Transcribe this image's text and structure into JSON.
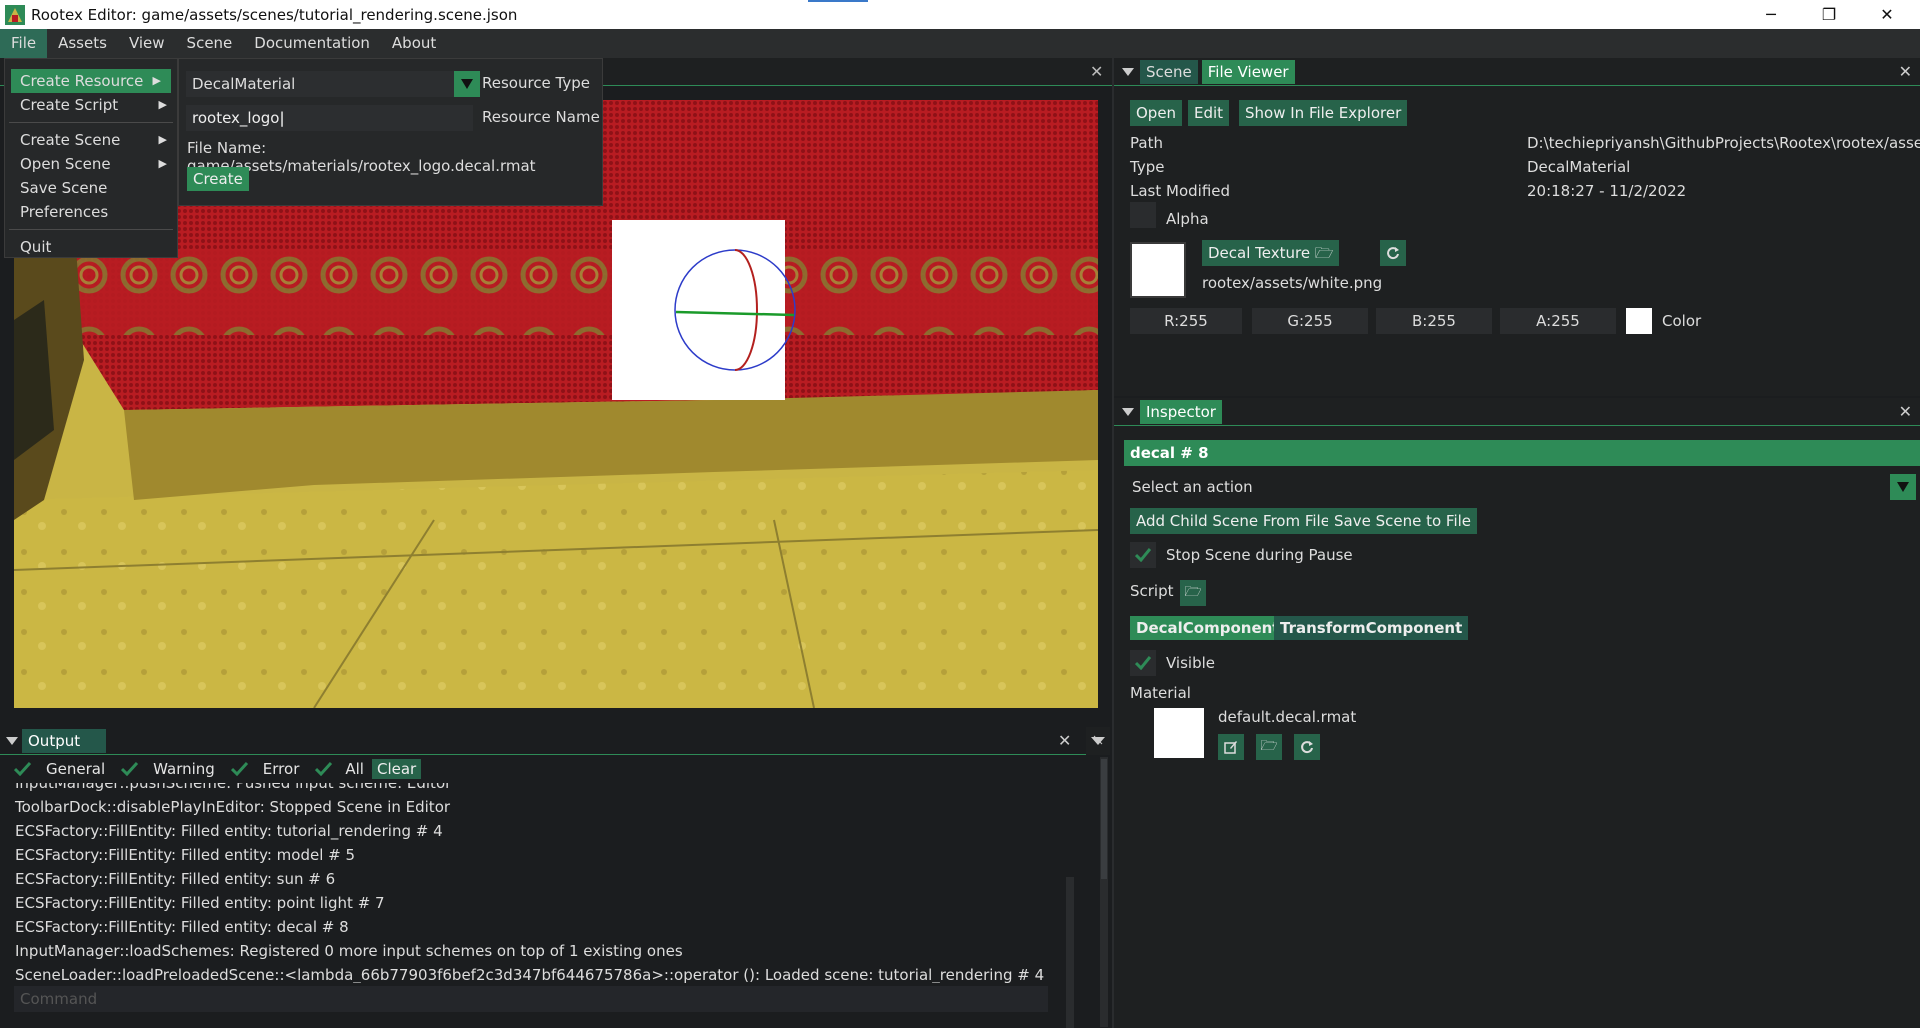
{
  "window": {
    "title": "Rootex Editor: game/assets/scenes/tutorial_rendering.scene.json",
    "minimize": "─",
    "maximize": "❐",
    "close": "✕"
  },
  "menubar": [
    "File",
    "Assets",
    "View",
    "Scene",
    "Documentation",
    "About"
  ],
  "file_menu": {
    "items": [
      {
        "label": "Create Resource",
        "submenu": true
      },
      {
        "label": "Create Script",
        "submenu": true
      },
      {
        "label": "Create Scene",
        "submenu": true
      },
      {
        "label": "Open Scene",
        "submenu": true
      },
      {
        "label": "Save Scene",
        "submenu": false
      },
      {
        "label": "Preferences",
        "submenu": false
      },
      {
        "label": "Quit",
        "submenu": false
      }
    ]
  },
  "create_resource": {
    "type_value": "DecalMaterial",
    "type_label": "Resource Type",
    "name_value": "rootex_logo",
    "name_label": "Resource Name",
    "file_name": "File Name: game/assets/materials/rootex_logo.decal.rmat",
    "create_label": "Create"
  },
  "file_viewer": {
    "tabs": [
      "Scene",
      "File Viewer"
    ],
    "buttons": [
      "Open",
      "Edit",
      "Show In File Explorer"
    ],
    "path_label": "Path",
    "path_value": "D:\\techiepriyansh\\GithubProjects\\Rootex\\rootex/assets/",
    "type_label": "Type",
    "type_value": "DecalMaterial",
    "modified_label": "Last Modified",
    "modified_value": "20:18:27 - 11/2/2022",
    "alpha_label": "Alpha",
    "decal_texture_label": "Decal Texture",
    "texture_path": "rootex/assets/white.png",
    "r": "R:255",
    "g": "G:255",
    "b": "B:255",
    "a": "A:255",
    "color_label": "Color"
  },
  "inspector": {
    "tab": "Inspector",
    "entity": "decal # 8",
    "action_placeholder": "Select an action",
    "add_child": "Add Child Scene From File",
    "save_scene": "Save Scene to File",
    "stop_scene": "Stop Scene during Pause",
    "script_label": "Script",
    "components": [
      "DecalComponent",
      "TransformComponent"
    ],
    "visible_label": "Visible",
    "material_label": "Material",
    "material_value": "default.decal.rmat"
  },
  "output": {
    "tab": "Output",
    "filters": [
      "General",
      "Warning",
      "Error",
      "All"
    ],
    "clear_label": "Clear",
    "lines": [
      "InputManager::pushScheme: Pushed input scheme: Editor",
      "ToolbarDock::disablePlayInEditor: Stopped Scene in Editor",
      "ECSFactory::FillEntity: Filled entity: tutorial_rendering # 4",
      "ECSFactory::FillEntity: Filled entity: model # 5",
      "ECSFactory::FillEntity: Filled entity: sun # 6",
      "ECSFactory::FillEntity: Filled entity: point light # 7",
      "ECSFactory::FillEntity: Filled entity: decal # 8",
      "InputManager::loadSchemes: Registered 0 more input schemes on top of 1 existing ones",
      "SceneLoader::loadPreloadedScene::<lambda_66b77903f6bef2c3d347bf644675786a>::operator (): Loaded scene: tutorial_rendering # 4"
    ],
    "command_placeholder": "Command"
  },
  "colors": {
    "accent": "#2e8b57",
    "curtain": "#b81c22",
    "floor": "#c8b445"
  }
}
